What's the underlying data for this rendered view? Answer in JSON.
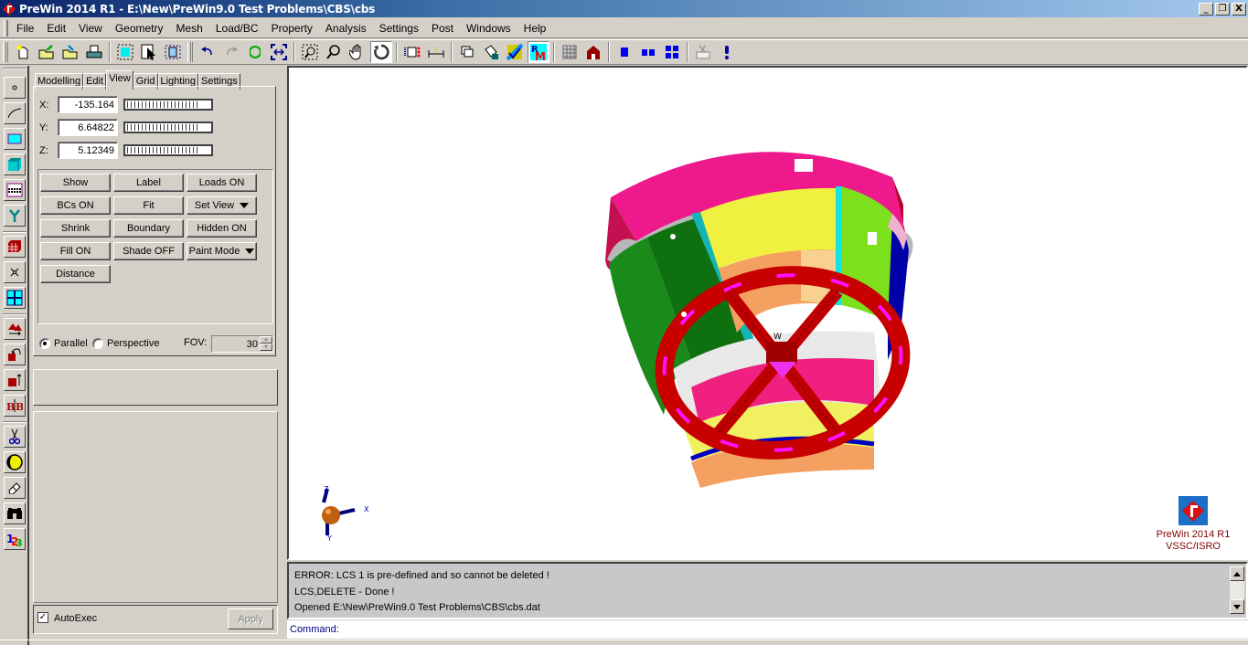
{
  "window": {
    "title": "PreWin 2014 R1 - E:\\New\\PreWin9.0 Test Problems\\CBS\\cbs",
    "minimize": "_",
    "restore": "❐",
    "close": "X"
  },
  "menu": [
    "File",
    "Edit",
    "View",
    "Geometry",
    "Mesh",
    "Load/BC",
    "Property",
    "Analysis",
    "Settings",
    "Post",
    "Windows",
    "Help"
  ],
  "toolbar": {
    "groups": [
      [
        "new-file-icon",
        "open-file-icon",
        "import-file-icon",
        "print-icon"
      ],
      [
        "select-box-icon",
        "select-pointer-icon",
        "select-window-icon"
      ],
      [
        "undo-icon",
        "redo-icon",
        "refresh-icon",
        "fit-extents-icon"
      ],
      [
        "zoom-window-icon",
        "zoom-icon",
        "pan-hand-icon",
        "rotate-icon"
      ],
      [
        "node-numbering-icon",
        "measure-icon"
      ],
      [
        "copy-icon",
        "paint-bucket-icon",
        "color-map-icon",
        "rm-mode-icon"
      ],
      [
        "grid-select-icon",
        "house-icon"
      ],
      [
        "single-view-icon",
        "two-views-icon",
        "four-views-icon"
      ],
      [
        "keyboard-icon",
        "exclamation-icon"
      ]
    ]
  },
  "left_tools": [
    "point-icon",
    "curve-icon",
    "surface-icon",
    "solid-icon",
    "mesh-layer-icon",
    "branch-icon",
    "brick-mesh-icon",
    "cross-node-icon",
    "grid-quad-icon",
    "extrude-icon",
    "rotate-elements-icon",
    "translate-elements-icon",
    "mirror-icon",
    "cut-scissors-icon",
    "material-sphere-icon",
    "eraser-icon",
    "binoculars-icon",
    "numbering-123-icon"
  ],
  "panel": {
    "tabs": [
      "Modelling",
      "Edit",
      "View",
      "Grid",
      "Lighting",
      "Settings"
    ],
    "active_tab": "View",
    "coords": [
      {
        "label": "X:",
        "value": "-135.164"
      },
      {
        "label": "Y:",
        "value": "6.64822"
      },
      {
        "label": "Z:",
        "value": "5.12349"
      }
    ],
    "buttons": [
      {
        "label": "Show",
        "dropdown": false
      },
      {
        "label": "Label",
        "dropdown": false
      },
      {
        "label": "Loads ON",
        "dropdown": false
      },
      {
        "label": "BCs ON",
        "dropdown": false
      },
      {
        "label": "Fit",
        "dropdown": false
      },
      {
        "label": "Set View",
        "dropdown": true
      },
      {
        "label": "Shrink",
        "dropdown": false
      },
      {
        "label": "Boundary",
        "dropdown": false
      },
      {
        "label": "Hidden ON",
        "dropdown": false
      },
      {
        "label": "Fill ON",
        "dropdown": false
      },
      {
        "label": "Shade OFF",
        "dropdown": false
      },
      {
        "label": "Paint Mode",
        "dropdown": true
      },
      {
        "label": "Distance",
        "dropdown": false
      }
    ],
    "projection": {
      "parallel": "Parallel",
      "perspective": "Perspective",
      "selected": "Parallel"
    },
    "fov": {
      "label": "FOV:",
      "value": "30"
    },
    "autoexec": {
      "label": "AutoExec",
      "checked": true
    },
    "apply": "Apply"
  },
  "viewport": {
    "axis_labels": {
      "x": "X",
      "y": "Y",
      "z": "Z"
    },
    "model_label": "W",
    "logo_line1": "PreWin 2014 R1",
    "logo_line2": "VSSC/ISRO"
  },
  "console": {
    "lines": [
      "ERROR: LCS 1 is pre-defined and so cannot be deleted !",
      "LCS,DELETE - Done !",
      "Opened E:\\New\\PreWin9.0 Test Problems\\CBS\\cbs.dat"
    ],
    "command_label": "Command:",
    "command_value": ""
  }
}
